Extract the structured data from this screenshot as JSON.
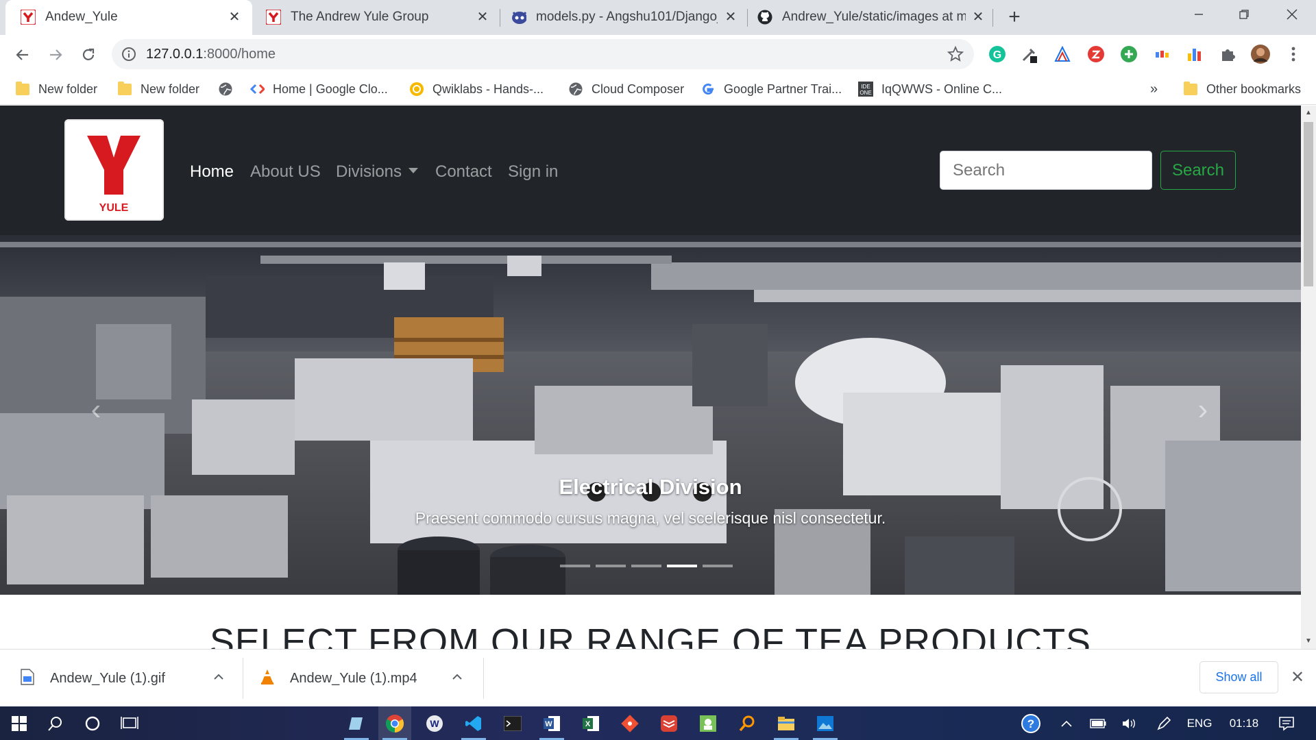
{
  "browser": {
    "tabs": [
      {
        "title": "Andew_Yule",
        "favicon": "yule-favicon",
        "active": true
      },
      {
        "title": "The Andrew Yule Group",
        "favicon": "yule-favicon",
        "active": false
      },
      {
        "title": "models.py - Angshu101/Django_",
        "favicon": "github-octocat-icon",
        "active": false
      },
      {
        "title": "Andrew_Yule/static/images at m",
        "favicon": "github-icon",
        "active": false
      }
    ],
    "url_host": "127.0.0.1",
    "url_rest": ":8000/home",
    "bookmarks": [
      {
        "label": "New folder",
        "icon": "folder-icon"
      },
      {
        "label": "New folder",
        "icon": "folder-icon"
      },
      {
        "label": "",
        "icon": "globe-icon"
      },
      {
        "label": "Home | Google Clo...",
        "icon": "google-cloud-icon"
      },
      {
        "label": "Qwiklabs - Hands-...",
        "icon": "qwiklabs-icon"
      },
      {
        "label": "Cloud Composer",
        "icon": "globe-icon"
      },
      {
        "label": "Google Partner Trai...",
        "icon": "google-icon"
      },
      {
        "label": "IqQWWS - Online C...",
        "icon": "ideone-icon"
      }
    ],
    "bookmarks_overflow": "»",
    "other_bookmarks": "Other bookmarks"
  },
  "site": {
    "logo_text": "YULE",
    "nav": [
      {
        "label": "Home",
        "active": true
      },
      {
        "label": "About US",
        "active": false
      },
      {
        "label": "Divisions",
        "active": false,
        "dropdown": true
      },
      {
        "label": "Contact",
        "active": false
      },
      {
        "label": "Sign in",
        "active": false
      }
    ],
    "search_placeholder": "Search",
    "search_button": "Search",
    "carousel": {
      "title": "Electrical Division",
      "text": "Praesent commodo cursus magna, vel scelerisque nisl consectetur.",
      "slides": 5,
      "active_slide": 4
    },
    "section_heading": "SELECT FROM OUR RANGE OF TEA PRODUCTS"
  },
  "downloads": {
    "items": [
      {
        "name": "Andew_Yule (1).gif",
        "icon": "gif-file-icon"
      },
      {
        "name": "Andew_Yule (1).mp4",
        "icon": "vlc-icon"
      }
    ],
    "show_all": "Show all"
  },
  "taskbar": {
    "language": "ENG",
    "time": "01:18"
  },
  "colors": {
    "navbar_bg": "#212529",
    "search_btn": "#28a745",
    "logo_red": "#d71920"
  }
}
